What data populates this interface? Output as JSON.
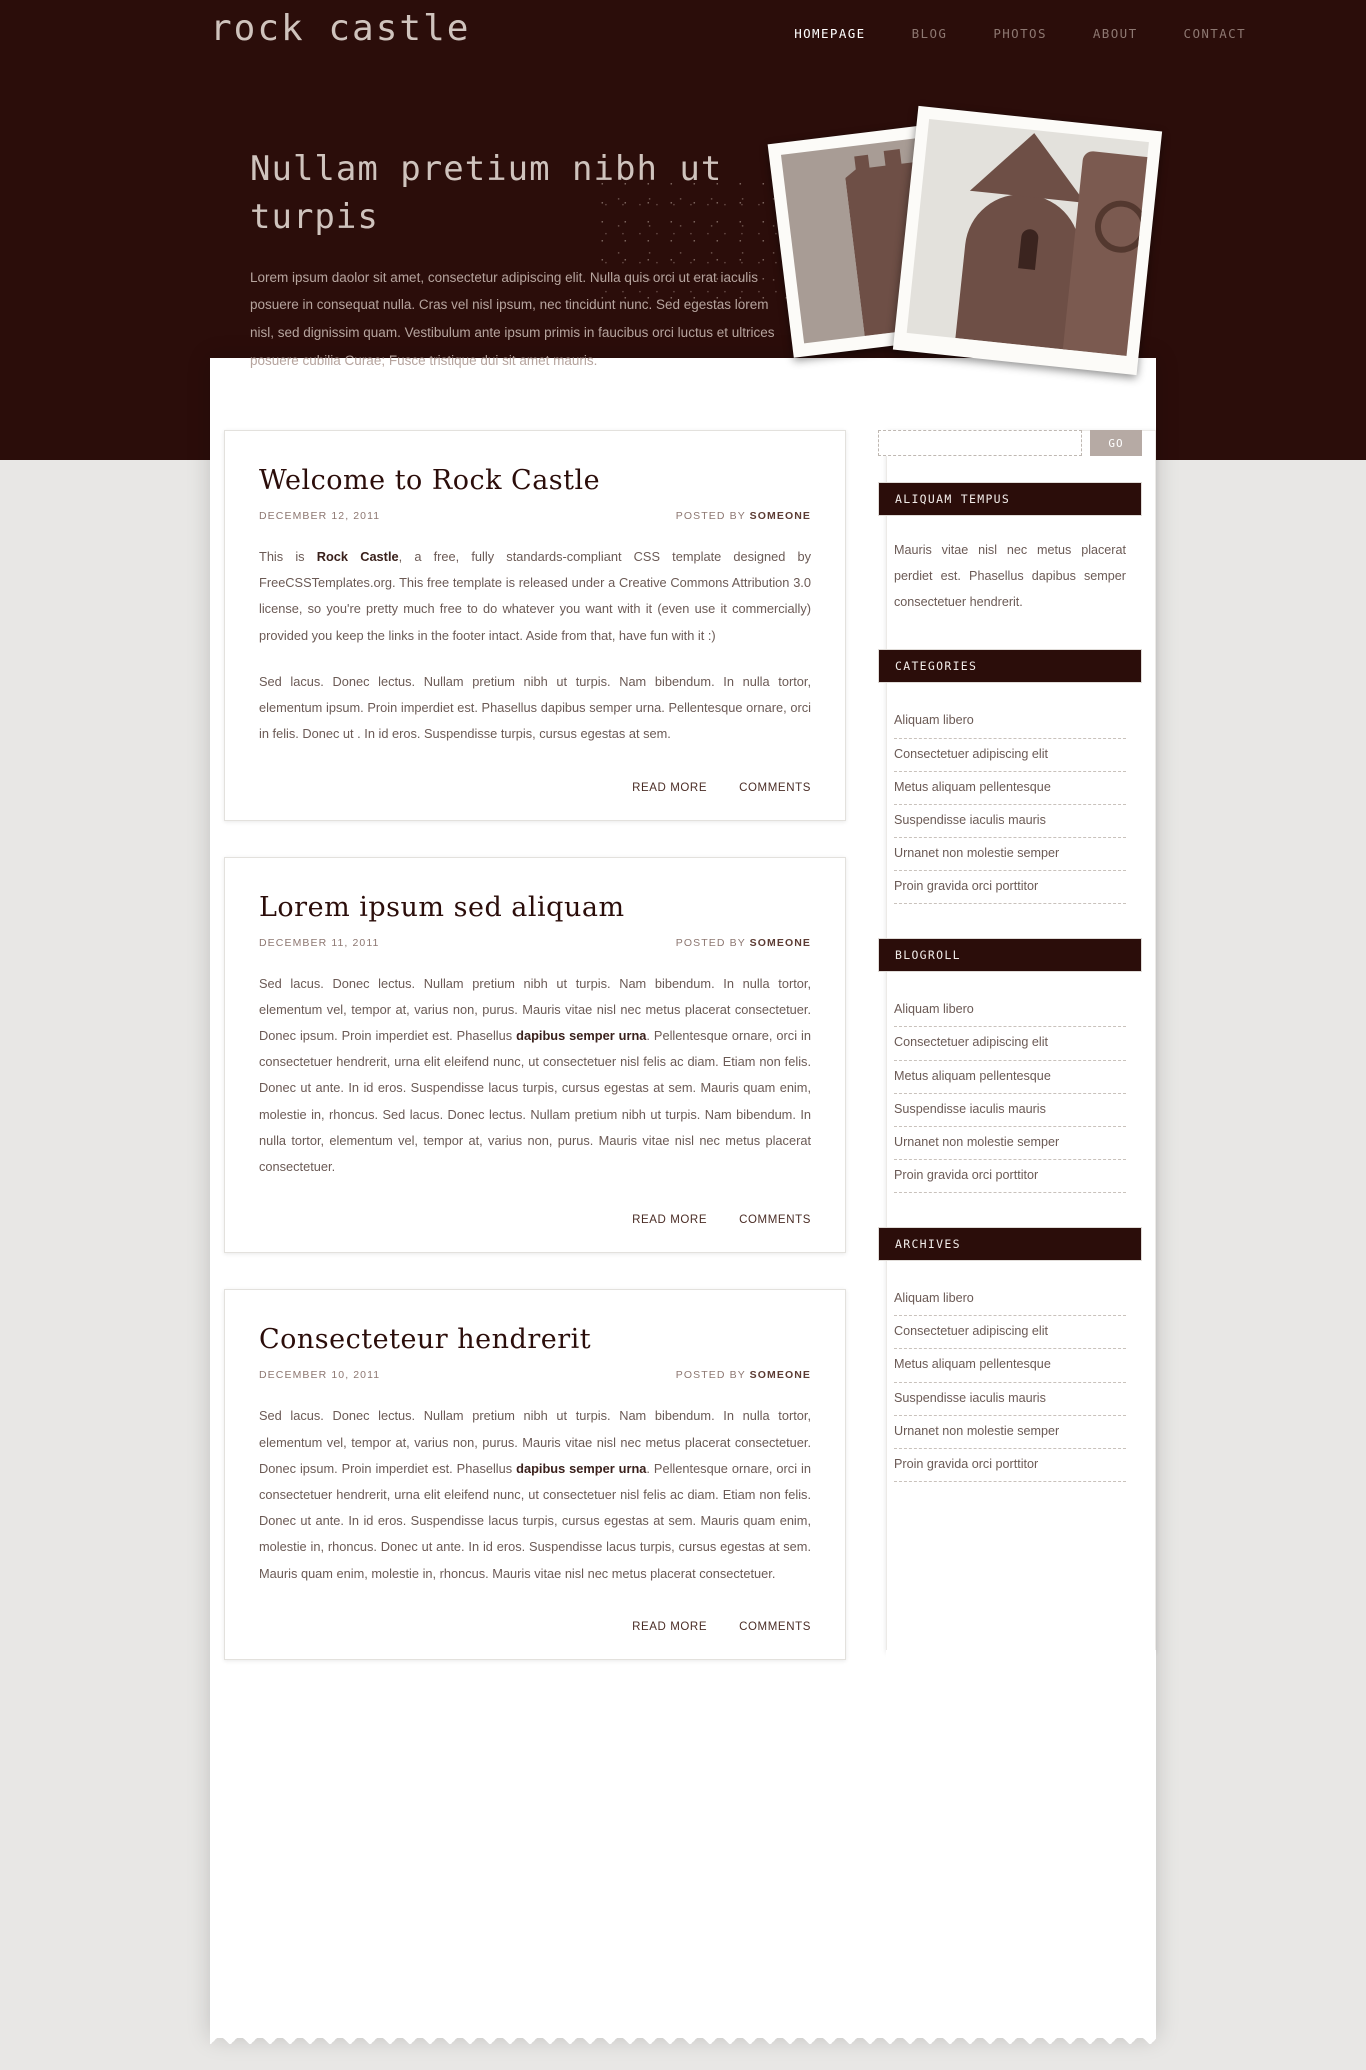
{
  "site": {
    "logo": "rock castle",
    "nav": [
      {
        "label": "HOMEPAGE",
        "active": true
      },
      {
        "label": "BLOG",
        "active": false
      },
      {
        "label": "PHOTOS",
        "active": false
      },
      {
        "label": "ABOUT",
        "active": false
      },
      {
        "label": "CONTACT",
        "active": false
      }
    ]
  },
  "hero": {
    "title": "Nullam pretium nibh ut turpis",
    "text": "Lorem ipsum daolor sit amet, consectetur adipiscing elit. Nulla quis orci ut erat iaculis posuere in consequat nulla. Cras vel nisl ipsum, nec tincidunt nunc. Sed egestas lorem nisl, sed dignissim quam. Vestibulum ante ipsum primis in faucibus orci luctus et ultrices posuere cubilia Curae; Fusce tristique dui sit amet mauris."
  },
  "photos": [
    {
      "name": "castle-tower-photo",
      "alt": "Stone castle tower ruin"
    },
    {
      "name": "round-tower-photo",
      "alt": "Round tower and celtic cross"
    }
  ],
  "posts": [
    {
      "title": "Welcome to Rock Castle",
      "date": "DECEMBER 12, 2011",
      "posted_by_label": "POSTED BY",
      "author": "SOMEONE",
      "paragraphs": [
        "This is <strong>Rock Castle</strong>, a free, fully standards-compliant CSS template designed by FreeCSSTemplates.org. This free template is released under a Creative Commons Attribution 3.0 license, so you're pretty much free to do whatever you want with it (even use it commercially) provided you keep the links in the footer intact. Aside from that, have fun with it :)",
        "Sed lacus. Donec lectus. Nullam pretium nibh ut turpis. Nam bibendum. In nulla tortor, elementum ipsum. Proin imperdiet est. Phasellus dapibus semper urna. Pellentesque ornare, orci in felis. Donec ut . In id eros. Suspendisse turpis, cursus egestas at sem."
      ],
      "read_more": "READ MORE",
      "comments": "COMMENTS"
    },
    {
      "title": "Lorem ipsum sed aliquam",
      "date": "DECEMBER 11, 2011",
      "posted_by_label": "POSTED BY",
      "author": "SOMEONE",
      "paragraphs": [
        "Sed lacus. Donec lectus. Nullam pretium nibh ut turpis. Nam bibendum. In nulla tortor, elementum vel, tempor at, varius non, purus. Mauris vitae nisl nec metus placerat consectetuer. Donec ipsum. Proin imperdiet est. Phasellus <strong>dapibus semper urna</strong>. Pellentesque ornare, orci in consectetuer hendrerit, urna elit eleifend nunc, ut consectetuer nisl felis ac diam. Etiam non felis. Donec ut ante. In id eros. Suspendisse lacus turpis, cursus egestas at sem. Mauris quam enim, molestie in, rhoncus. Sed lacus. Donec lectus. Nullam pretium nibh ut turpis. Nam bibendum. In nulla tortor, elementum vel, tempor at, varius non, purus. Mauris vitae nisl nec metus placerat consectetuer."
      ],
      "read_more": "READ MORE",
      "comments": "COMMENTS"
    },
    {
      "title": "Consecteteur hendrerit",
      "date": "DECEMBER 10, 2011",
      "posted_by_label": "POSTED BY",
      "author": "SOMEONE",
      "paragraphs": [
        "Sed lacus. Donec lectus. Nullam pretium nibh ut turpis. Nam bibendum. In nulla tortor, elementum vel, tempor at, varius non, purus. Mauris vitae nisl nec metus placerat consectetuer. Donec ipsum. Proin imperdiet est. Phasellus <strong>dapibus semper urna</strong>. Pellentesque ornare, orci in consectetuer hendrerit, urna elit eleifend nunc, ut consectetuer nisl felis ac diam. Etiam non felis. Donec ut ante. In id eros. Suspendisse lacus turpis, cursus egestas at sem. Mauris quam enim, molestie in, rhoncus. Donec ut ante. In id eros. Suspendisse lacus turpis, cursus egestas at sem. Mauris quam enim, molestie in, rhoncus. Mauris vitae nisl nec metus placerat consectetuer."
      ],
      "read_more": "READ MORE",
      "comments": "COMMENTS"
    }
  ],
  "sidebar": {
    "search": {
      "value": "",
      "placeholder": "",
      "button_label": "GO"
    },
    "widgets": [
      {
        "heading": "ALIQUAM TEMPUS",
        "type": "text",
        "text": "Mauris vitae nisl nec metus placerat perdiet est. Phasellus dapibus semper consectetuer hendrerit."
      },
      {
        "heading": "CATEGORIES",
        "type": "list",
        "items": [
          "Aliquam libero",
          "Consectetuer adipiscing elit",
          "Metus aliquam pellentesque",
          "Suspendisse iaculis mauris",
          "Urnanet non molestie semper",
          "Proin gravida orci porttitor"
        ]
      },
      {
        "heading": "BLOGROLL",
        "type": "list",
        "items": [
          "Aliquam libero",
          "Consectetuer adipiscing elit",
          "Metus aliquam pellentesque",
          "Suspendisse iaculis mauris",
          "Urnanet non molestie semper",
          "Proin gravida orci porttitor"
        ]
      },
      {
        "heading": "ARCHIVES",
        "type": "list",
        "items": [
          "Aliquam libero",
          "Consectetuer adipiscing elit",
          "Metus aliquam pellentesque",
          "Suspendisse iaculis mauris",
          "Urnanet non molestie semper",
          "Proin gravida orci porttitor"
        ]
      }
    ]
  },
  "colors": {
    "dark_brown": "#2b0d0a",
    "muted_tan": "#b6a49e",
    "body_text": "#6b5a55",
    "page_grey": "#e8e7e5",
    "button_grey": "#b6aaa4"
  }
}
